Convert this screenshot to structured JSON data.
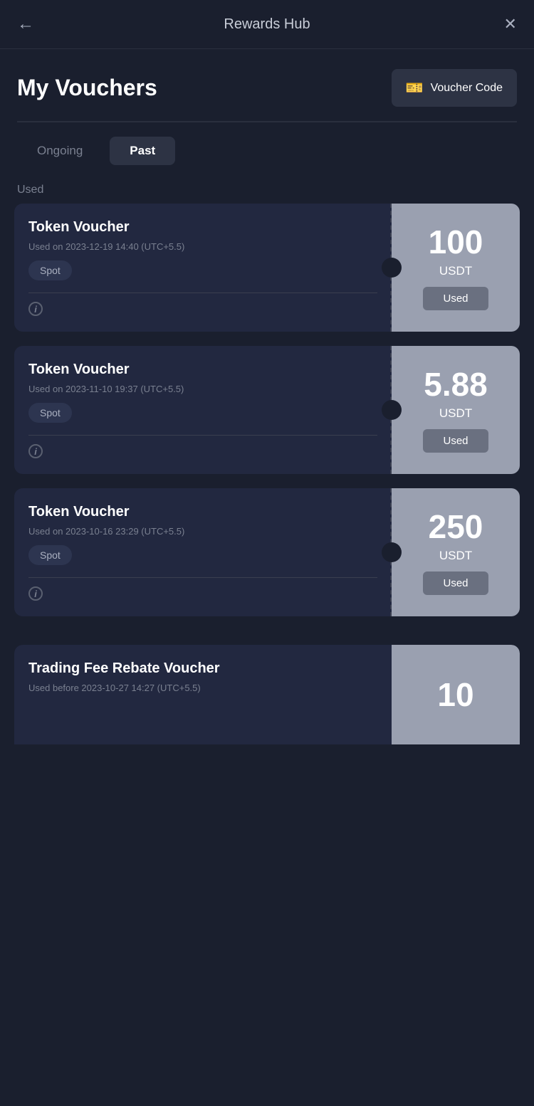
{
  "header": {
    "title": "Rewards Hub",
    "back_icon": "←",
    "close_icon": "✕"
  },
  "page": {
    "title": "My Vouchers",
    "voucher_code_btn": "Voucher Code"
  },
  "tabs": [
    {
      "id": "ongoing",
      "label": "Ongoing",
      "active": false
    },
    {
      "id": "past",
      "label": "Past",
      "active": true
    }
  ],
  "section_label": "Used",
  "vouchers": [
    {
      "id": 1,
      "type": "Token Voucher",
      "date": "Used on 2023-12-19 14:40 (UTC+5.5)",
      "tag": "Spot",
      "amount": "100",
      "currency": "USDT",
      "status": "Used"
    },
    {
      "id": 2,
      "type": "Token Voucher",
      "date": "Used on 2023-11-10 19:37 (UTC+5.5)",
      "tag": "Spot",
      "amount": "5.88",
      "currency": "USDT",
      "status": "Used"
    },
    {
      "id": 3,
      "type": "Token Voucher",
      "date": "Used on 2023-10-16 23:29 (UTC+5.5)",
      "tag": "Spot",
      "amount": "250",
      "currency": "USDT",
      "status": "Used"
    }
  ],
  "partial_voucher": {
    "type": "Trading Fee Rebate Voucher",
    "date": "Used before 2023-10-27 14:27 (UTC+5.5)",
    "amount": "10"
  }
}
